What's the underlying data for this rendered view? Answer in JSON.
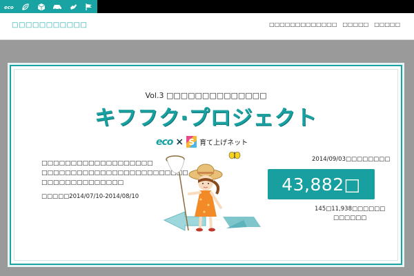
{
  "colors": {
    "accent": "#1aa3a3",
    "top_bar": "#000000",
    "background": "#9a9a9a"
  },
  "topbar": {
    "icons": [
      "eco-icon",
      "leaf-icon",
      "box-icon",
      "car-icon",
      "hand-icon",
      "flag-icon"
    ]
  },
  "header": {
    "site_title": "□□□□□□□□□□□",
    "nav": [
      "□□□□□□□□□□□□□",
      "□□□□□",
      "□□□□□"
    ]
  },
  "hero": {
    "subtitle": "Vol.3 □□□□□□□□□□□□□□",
    "title": "キフフク·プロジェクト",
    "partner_eco": "eco",
    "partner_times": "×",
    "partner_s": "S",
    "partner_name": "育て上げネット",
    "description": [
      "□□□□□□□□□□□□□□□□□□□",
      "□□□□□□□□□□□□□□□□□□□□□□□□□",
      "□□□□□□□□□□□□□□"
    ],
    "period": "□□□□□2014/07/10-2014/08/10",
    "as_of": "2014/09/03□□□□□□□□",
    "counter": "43,882□",
    "counter_note": "145□11,938□□□□□□",
    "counter_note2": "□□□□□□"
  }
}
